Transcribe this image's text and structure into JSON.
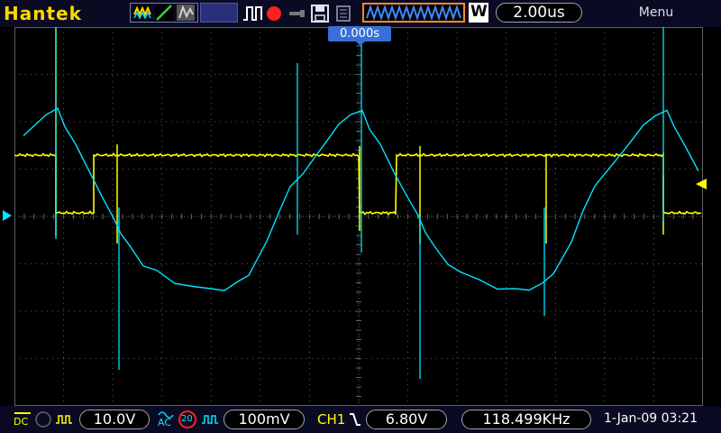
{
  "brand": "Hantek",
  "toolbar": {
    "timebase": "2.00us",
    "menu_label": "Menu",
    "acquisition_mode_label": "W"
  },
  "screen": {
    "trigger_time_offset": "0.000s"
  },
  "channels": {
    "ch1": {
      "color": "#ffff00",
      "coupling": "DC",
      "volts_per_div": "10.0V"
    },
    "ch2": {
      "color": "#00e5ff",
      "coupling": "AC",
      "bandwidth_limit": "20",
      "volts_per_div": "100mV"
    }
  },
  "trigger": {
    "source": "CH1",
    "edge": "falling",
    "level": "6.80V"
  },
  "frequency": "118.499KHz",
  "datetime": "1-Jan-09 03:21",
  "colors": {
    "toolbar_bg": "#0a0a22",
    "brand": "#ffd800",
    "grid": "#606060",
    "ch1_trace": "#ffff00",
    "ch2_trace": "#00e5ff",
    "accent_blue": "#3870d8",
    "record": "#ff2020"
  }
}
